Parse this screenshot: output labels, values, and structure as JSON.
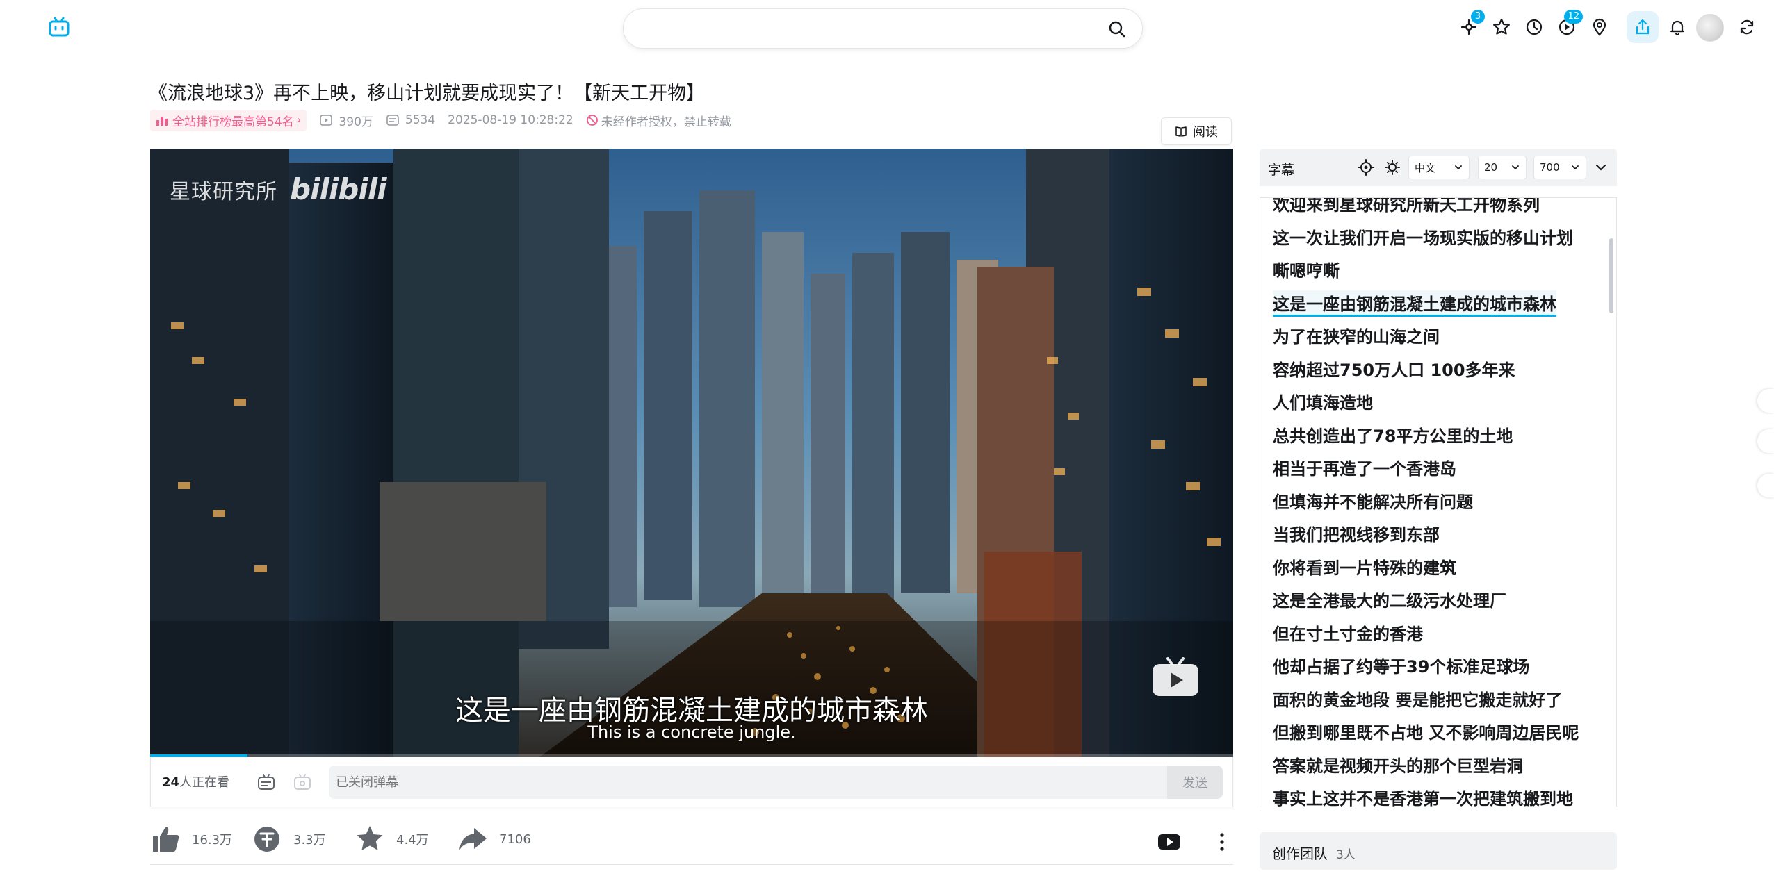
{
  "header": {
    "search_value": "",
    "icons": [
      "bilibili-tv-icon",
      "search-icon",
      "dynamic-icon",
      "favorites-icon",
      "history-icon",
      "creation-icon",
      "location-icon",
      "upload-share-icon",
      "notification-icon",
      "avatar",
      "refresh-icon"
    ],
    "dynamic_badge": "3",
    "creation_badge": "12"
  },
  "video": {
    "title": "《流浪地球3》再不上映，移山计划就要成现实了！【新天工开物】",
    "rank_label": "全站排行榜最高第54名",
    "views": "390万",
    "danmaku_count": "5534",
    "publish_time": "2025-08-19 10:28:22",
    "copyright_notice": "未经作者授权，禁止转载",
    "read_button": "阅读",
    "watermark_text": "星球研究所",
    "watermark_brand": "bilibili",
    "subtitle_cn": "这是一座由钢筋混凝土建成的城市森林",
    "subtitle_en": "This is a concrete jungle.",
    "progress_fraction": 0.09
  },
  "danmaku": {
    "viewers_count": "24",
    "viewers_suffix": "人正在看",
    "input_placeholder": "已关闭弹幕",
    "send_label": "发送"
  },
  "actions": {
    "like": "16.3万",
    "coin": "3.3万",
    "favorite": "4.4万",
    "share": "7106"
  },
  "subtitle_panel": {
    "title": "字幕",
    "language": "中文",
    "font_size": "20",
    "font_weight": "700",
    "lines": [
      "欢迎来到星球研究所新天工开物系列",
      "这一次让我们开启一场现实版的移山计划",
      "嘶嗯哼嘶",
      "这是一座由钢筋混凝土建成的城市森林",
      "为了在狭窄的山海之间",
      "容纳超过750万人口 100多年来",
      "人们填海造地",
      "总共创造出了78平方公里的土地",
      "相当于再造了一个香港岛",
      "但填海并不能解决所有问题",
      "当我们把视线移到东部",
      "你将看到一片特殊的建筑",
      "这是全港最大的二级污水处理厂",
      "但在寸土寸金的香港",
      "他却占据了约等于39个标准足球场",
      "面积的黄金地段 要是能把它搬走就好了",
      "但搬到哪里既不占地 又不影响周边居民呢",
      "答案就是视频开头的那个巨型岩洞",
      "事实上这并不是香港第一次把建筑搬到地"
    ],
    "active_index": 3
  },
  "team": {
    "title": "创作团队",
    "count": "3人"
  },
  "colors": {
    "accent": "#00aeec",
    "rank_pink": "#f25d8e",
    "text_primary": "#18191c",
    "text_secondary": "#9499a0"
  }
}
